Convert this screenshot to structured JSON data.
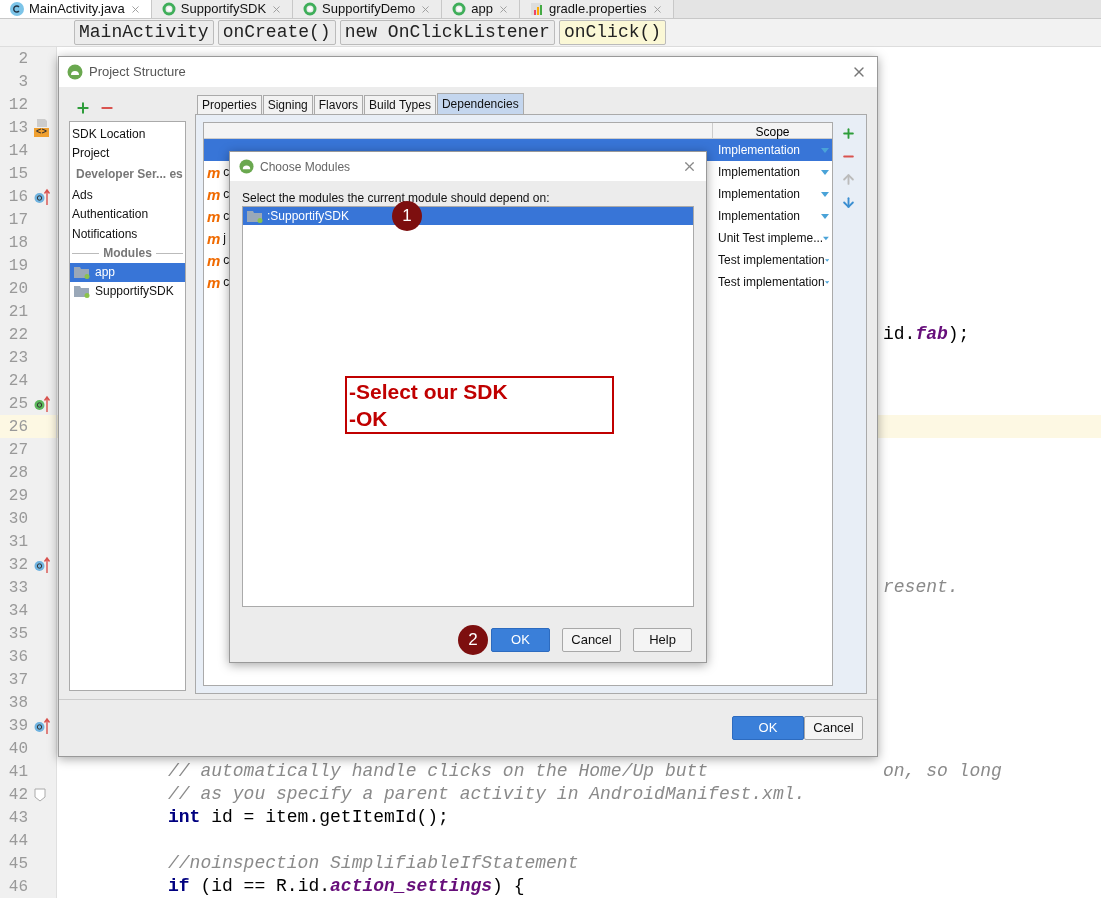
{
  "editor_tabs": [
    {
      "label": "MainActivity.java",
      "kind": "class",
      "selected": true
    },
    {
      "label": "SupportifySDK",
      "kind": "module",
      "selected": false
    },
    {
      "label": "SupportifyDemo",
      "kind": "module",
      "selected": false
    },
    {
      "label": "app",
      "kind": "module",
      "selected": false
    },
    {
      "label": "gradle.properties",
      "kind": "gradle",
      "selected": false
    }
  ],
  "breadcrumbs": [
    {
      "label": "MainActivity",
      "selected": false
    },
    {
      "label": "onCreate()",
      "selected": false
    },
    {
      "label": "new OnClickListener",
      "selected": false
    },
    {
      "label": "onClick()",
      "selected": true
    }
  ],
  "code_lines": [
    {
      "number": "2",
      "kind": "plain",
      "current": false
    },
    {
      "number": "3",
      "kind": "plain",
      "current": false
    },
    {
      "number": "12",
      "kind": "plain",
      "current": false
    },
    {
      "number": "13",
      "kind": "tag",
      "current": false,
      "marker_text": "<>"
    },
    {
      "number": "14",
      "kind": "plain",
      "current": false
    },
    {
      "number": "15",
      "kind": "plain",
      "current": false
    },
    {
      "number": "16",
      "kind": "override",
      "current": false
    },
    {
      "number": "17",
      "kind": "plain",
      "current": false
    },
    {
      "number": "18",
      "kind": "plain",
      "current": false
    },
    {
      "number": "19",
      "kind": "plain",
      "current": false
    },
    {
      "number": "20",
      "kind": "plain",
      "current": false
    },
    {
      "number": "21",
      "kind": "plain",
      "current": false
    },
    {
      "number": "22",
      "kind": "plain",
      "current": false,
      "tail": [
        {
          "kind": "plain",
          "text": "id."
        },
        {
          "kind": "field",
          "text": "fab"
        },
        {
          "kind": "plain",
          "text": ");"
        }
      ]
    },
    {
      "number": "23",
      "kind": "plain",
      "current": false
    },
    {
      "number": "24",
      "kind": "plain",
      "current": false
    },
    {
      "number": "25",
      "kind": "implements",
      "current": false
    },
    {
      "number": "26",
      "kind": "plain",
      "current": true
    },
    {
      "number": "27",
      "kind": "plain",
      "current": false
    },
    {
      "number": "28",
      "kind": "plain",
      "current": false
    },
    {
      "number": "29",
      "kind": "plain",
      "current": false
    },
    {
      "number": "30",
      "kind": "plain",
      "current": false
    },
    {
      "number": "31",
      "kind": "plain",
      "current": false
    },
    {
      "number": "32",
      "kind": "override",
      "current": false
    },
    {
      "number": "33",
      "kind": "plain",
      "current": false,
      "tail": [
        {
          "kind": "comment",
          "text": "resent."
        }
      ]
    },
    {
      "number": "34",
      "kind": "plain",
      "current": false
    },
    {
      "number": "35",
      "kind": "plain",
      "current": false
    },
    {
      "number": "36",
      "kind": "plain",
      "current": false
    },
    {
      "number": "37",
      "kind": "plain",
      "current": false
    },
    {
      "number": "38",
      "kind": "plain",
      "current": false
    },
    {
      "number": "39",
      "kind": "override",
      "current": false
    },
    {
      "number": "40",
      "kind": "plain",
      "current": false
    },
    {
      "number": "41",
      "kind": "plain",
      "current": false,
      "code": [
        {
          "kind": "comment",
          "text": "// automatically handle clicks on the Home/Up butt"
        }
      ],
      "tail": [
        {
          "kind": "comment",
          "text": "on, so long"
        }
      ]
    },
    {
      "number": "42",
      "kind": "fold",
      "current": false,
      "code": [
        {
          "kind": "comment",
          "text": "// as you specify a parent activity in AndroidManifest.xml."
        }
      ]
    },
    {
      "number": "43",
      "kind": "plain",
      "current": false,
      "code": [
        {
          "kind": "keyword",
          "text": "int"
        },
        {
          "kind": "plain",
          "text": " id = item.getItemId();"
        }
      ]
    },
    {
      "number": "44",
      "kind": "plain",
      "current": false
    },
    {
      "number": "45",
      "kind": "plain",
      "current": false,
      "code": [
        {
          "kind": "comment",
          "text": "//noinspection SimplifiableIfStatement"
        }
      ]
    },
    {
      "number": "46",
      "kind": "plain",
      "current": false,
      "code": [
        {
          "kind": "keyword",
          "text": "if"
        },
        {
          "kind": "plain",
          "text": " (id == R.id."
        },
        {
          "kind": "field",
          "text": "action_settings"
        },
        {
          "kind": "plain",
          "text": ") {"
        }
      ]
    }
  ],
  "project_structure": {
    "title": "Project Structure",
    "sidebar": [
      {
        "label": "SDK Location",
        "kind": "item",
        "selected": false
      },
      {
        "label": "Project",
        "kind": "item",
        "selected": false
      },
      {
        "label": "Developer Ser... es",
        "kind": "header",
        "selected": false
      },
      {
        "label": "Ads",
        "kind": "item",
        "selected": false
      },
      {
        "label": "Authentication",
        "kind": "item",
        "selected": false
      },
      {
        "label": "Notifications",
        "kind": "item",
        "selected": false
      },
      {
        "label": "Modules",
        "kind": "separator",
        "selected": false
      },
      {
        "label": "app",
        "kind": "module",
        "selected": true
      },
      {
        "label": "SupportifySDK",
        "kind": "module",
        "selected": false
      }
    ],
    "tabs": [
      {
        "label": "Properties",
        "selected": false
      },
      {
        "label": "Signing",
        "selected": false
      },
      {
        "label": "Flavors",
        "selected": false
      },
      {
        "label": "Build Types",
        "selected": false
      },
      {
        "label": "Dependencies",
        "selected": true
      }
    ],
    "table": {
      "columns": [
        "Scope"
      ],
      "rows": [
        {
          "kind": "files",
          "scope": "Implementation",
          "selected": true
        },
        {
          "icon": "m",
          "name": "c",
          "kind": "maven",
          "scope": "Implementation",
          "selected": false
        },
        {
          "icon": "m",
          "name": "c",
          "kind": "maven",
          "scope": "Implementation",
          "selected": false
        },
        {
          "icon": "m",
          "name": "c",
          "kind": "maven",
          "scope": "Implementation",
          "selected": false
        },
        {
          "icon": "m",
          "name": "j",
          "kind": "maven",
          "scope": "Unit Test impleme...",
          "selected": false
        },
        {
          "icon": "m",
          "name": "c",
          "kind": "maven",
          "scope": "Test implementation",
          "selected": false
        },
        {
          "icon": "m",
          "name": "c",
          "kind": "maven",
          "scope": "Test implementation",
          "selected": false
        }
      ]
    },
    "buttons": [
      {
        "label": "OK",
        "default": true
      },
      {
        "label": "Cancel",
        "default": false
      }
    ]
  },
  "choose_modules": {
    "title": "Choose Modules",
    "prompt": "Select the modules the current module should depend on:",
    "modules": [
      {
        "label": ":SupportifySDK",
        "selected": true
      }
    ],
    "buttons": [
      {
        "label": "OK",
        "default": true
      },
      {
        "label": "Cancel",
        "default": false
      },
      {
        "label": "Help",
        "default": false
      }
    ]
  },
  "annotations": {
    "steps": [
      "1",
      "2"
    ],
    "note": [
      "-Select our SDK",
      "-OK"
    ]
  }
}
